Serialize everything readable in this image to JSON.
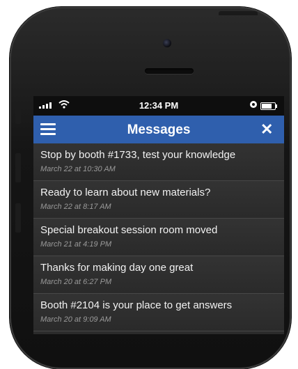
{
  "status_bar": {
    "time": "12:34 PM",
    "battery_level": 0.9
  },
  "header": {
    "title": "Messages",
    "close_label": "✕"
  },
  "messages": [
    {
      "title": "Stop by booth #1733, test your knowledge",
      "date": "March 22 at 10:30 AM"
    },
    {
      "title": "Ready to learn about new materials?",
      "date": "March 22 at 8:17 AM"
    },
    {
      "title": "Special breakout session room moved",
      "date": "March 21 at 4:19 PM"
    },
    {
      "title": "Thanks for making day one great",
      "date": "March 20 at 6:27 PM"
    },
    {
      "title": "Booth #2104 is your place to get answers",
      "date": "March 20 at 9:09 AM"
    }
  ],
  "colors": {
    "nav_bar": "#2f5fad",
    "list_bg": "#2b2b2b",
    "status_bar": "#0e0e0e"
  },
  "icons": {
    "menu": "hamburger-menu-icon",
    "close": "close-icon",
    "signal": "cellular-signal-icon",
    "wifi": "wifi-icon",
    "alarm": "alarm-icon",
    "battery": "battery-icon"
  }
}
